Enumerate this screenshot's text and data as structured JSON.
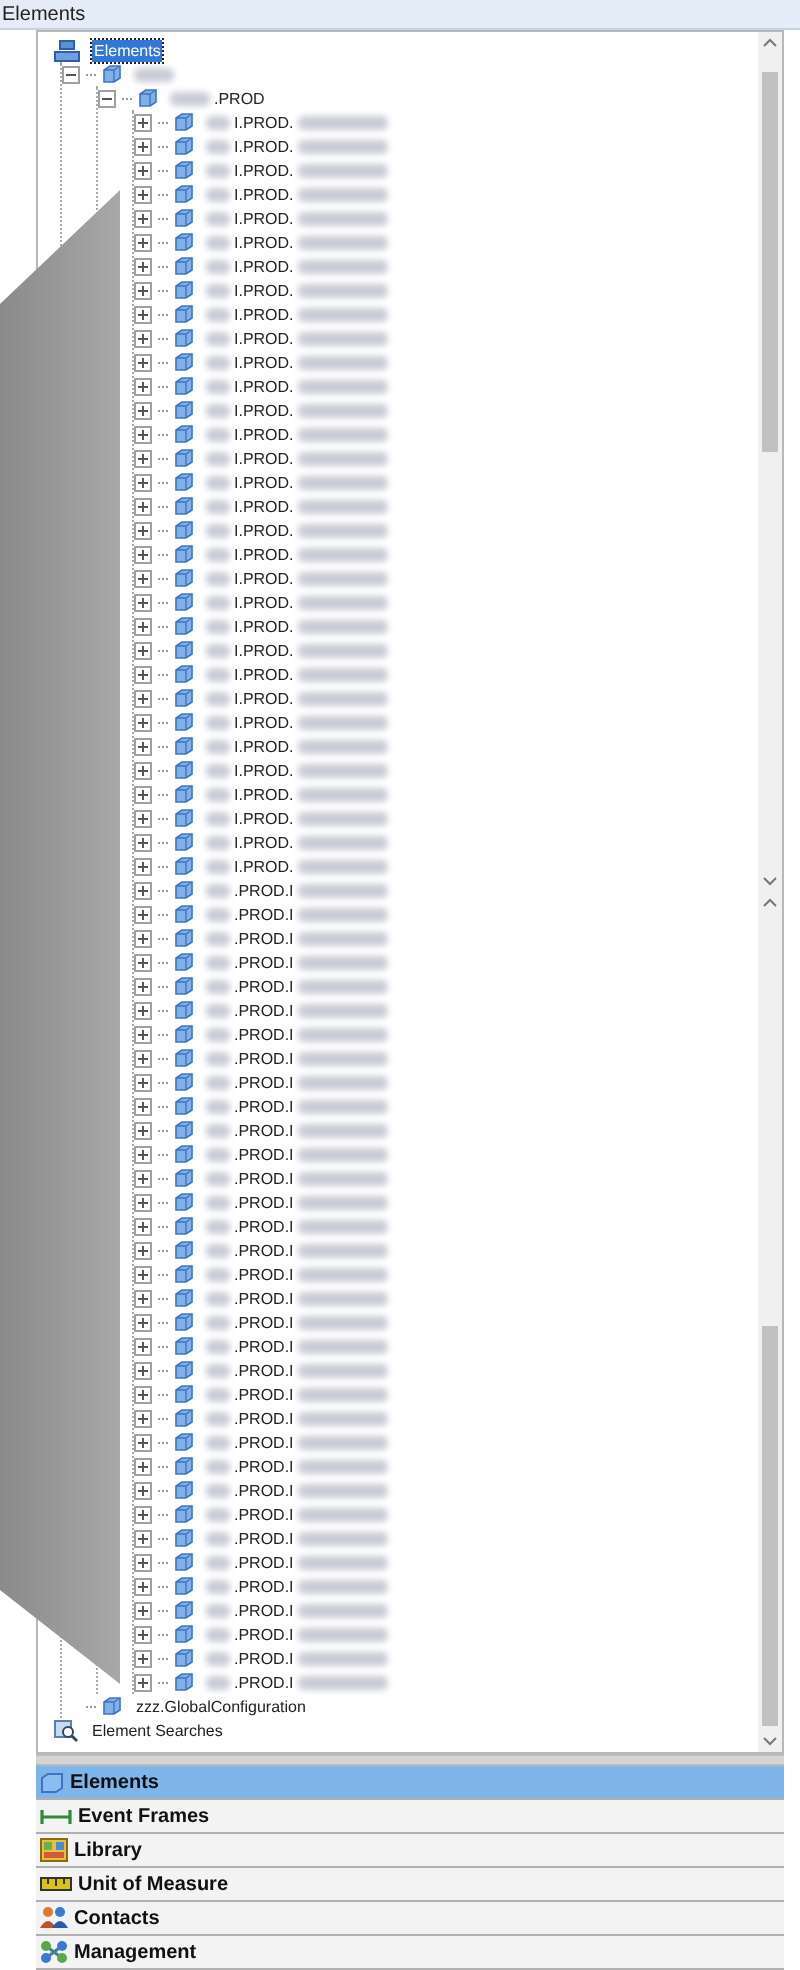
{
  "panel": {
    "title": "Elements"
  },
  "tree": [
    {
      "text": "Elements",
      "selected": true,
      "kind": "database",
      "children": [
        {
          "selected": false,
          "kind": "hidden",
          "expanded": true,
          "children": [
            {
              "text": ".PROD",
              "selected": false,
              "kind": "prod",
              "expanded": true,
              "children": [
                {
                  "text": "I.PROD.",
                  "selected": false,
                  "kind": "item",
                  "expanded": false
                },
                {
                  "text": "I.PROD.",
                  "selected": false,
                  "kind": "item",
                  "expanded": false
                },
                {
                  "text": "I.PROD.",
                  "selected": false,
                  "kind": "item",
                  "expanded": false
                },
                {
                  "text": "I.PROD.",
                  "selected": false,
                  "kind": "item",
                  "expanded": false
                },
                {
                  "text": "I.PROD.",
                  "selected": false,
                  "kind": "item",
                  "expanded": false
                },
                {
                  "text": "I.PROD.",
                  "selected": false,
                  "kind": "item",
                  "expanded": false
                },
                {
                  "text": "I.PROD.",
                  "selected": false,
                  "kind": "item",
                  "expanded": false
                },
                {
                  "text": "I.PROD.",
                  "selected": false,
                  "kind": "item",
                  "expanded": false
                },
                {
                  "text": "I.PROD.",
                  "selected": false,
                  "kind": "item",
                  "expanded": false
                },
                {
                  "text": "I.PROD.",
                  "selected": false,
                  "kind": "item",
                  "expanded": false
                },
                {
                  "text": "I.PROD.",
                  "selected": false,
                  "kind": "item",
                  "expanded": false
                },
                {
                  "text": "I.PROD.",
                  "selected": false,
                  "kind": "item",
                  "expanded": false
                },
                {
                  "text": "I.PROD.",
                  "selected": false,
                  "kind": "item",
                  "expanded": false
                },
                {
                  "text": "I.PROD.",
                  "selected": false,
                  "kind": "item",
                  "expanded": false
                },
                {
                  "text": "I.PROD.",
                  "selected": false,
                  "kind": "item",
                  "expanded": false
                },
                {
                  "text": "I.PROD.",
                  "selected": false,
                  "kind": "item",
                  "expanded": false
                },
                {
                  "text": "I.PROD.",
                  "selected": false,
                  "kind": "item",
                  "expanded": false
                },
                {
                  "text": "I.PROD.",
                  "selected": false,
                  "kind": "item",
                  "expanded": false
                },
                {
                  "text": "I.PROD.",
                  "selected": false,
                  "kind": "item",
                  "expanded": false
                },
                {
                  "text": "I.PROD.",
                  "selected": false,
                  "kind": "item",
                  "expanded": false
                },
                {
                  "text": "I.PROD.",
                  "selected": false,
                  "kind": "item",
                  "expanded": false
                },
                {
                  "text": "I.PROD.",
                  "selected": false,
                  "kind": "item",
                  "expanded": false
                },
                {
                  "text": "I.PROD.",
                  "selected": false,
                  "kind": "item",
                  "expanded": false
                },
                {
                  "text": "I.PROD.",
                  "selected": false,
                  "kind": "item",
                  "expanded": false
                },
                {
                  "text": "I.PROD.",
                  "selected": false,
                  "kind": "item",
                  "expanded": false
                },
                {
                  "text": "I.PROD.",
                  "selected": false,
                  "kind": "item",
                  "expanded": false
                },
                {
                  "text": "I.PROD.",
                  "selected": false,
                  "kind": "item",
                  "expanded": false
                },
                {
                  "text": "I.PROD.",
                  "selected": false,
                  "kind": "item",
                  "expanded": false
                },
                {
                  "text": "I.PROD.",
                  "selected": false,
                  "kind": "item",
                  "expanded": false
                },
                {
                  "text": "I.PROD.",
                  "selected": false,
                  "kind": "item",
                  "expanded": false
                },
                {
                  "text": "I.PROD.",
                  "selected": false,
                  "kind": "item",
                  "expanded": false
                },
                {
                  "text": "I.PROD.",
                  "selected": false,
                  "kind": "item",
                  "expanded": false
                },
                {
                  "text": ".PROD.I",
                  "selected": false,
                  "kind": "item",
                  "expanded": false
                },
                {
                  "text": ".PROD.I",
                  "selected": false,
                  "kind": "item",
                  "expanded": false
                },
                {
                  "text": ".PROD.I",
                  "selected": false,
                  "kind": "item",
                  "expanded": false
                },
                {
                  "text": ".PROD.I",
                  "selected": false,
                  "kind": "item",
                  "expanded": false
                },
                {
                  "text": ".PROD.I",
                  "selected": false,
                  "kind": "item",
                  "expanded": false
                },
                {
                  "text": ".PROD.I",
                  "selected": false,
                  "kind": "item",
                  "expanded": false
                },
                {
                  "text": ".PROD.I",
                  "selected": false,
                  "kind": "item",
                  "expanded": false
                },
                {
                  "text": ".PROD.I",
                  "selected": false,
                  "kind": "item",
                  "expanded": false
                },
                {
                  "text": ".PROD.I",
                  "selected": false,
                  "kind": "item",
                  "expanded": false
                },
                {
                  "text": ".PROD.I",
                  "selected": false,
                  "kind": "item",
                  "expanded": false
                },
                {
                  "text": ".PROD.I",
                  "selected": false,
                  "kind": "item",
                  "expanded": false
                },
                {
                  "text": ".PROD.I",
                  "selected": false,
                  "kind": "item",
                  "expanded": false
                },
                {
                  "text": ".PROD.I",
                  "selected": false,
                  "kind": "item",
                  "expanded": false
                },
                {
                  "text": ".PROD.I",
                  "selected": false,
                  "kind": "item",
                  "expanded": false
                },
                {
                  "text": ".PROD.I",
                  "selected": false,
                  "kind": "item",
                  "expanded": false
                },
                {
                  "text": ".PROD.I",
                  "selected": false,
                  "kind": "item",
                  "expanded": false
                },
                {
                  "text": ".PROD.I",
                  "selected": false,
                  "kind": "item",
                  "expanded": false
                },
                {
                  "text": ".PROD.I",
                  "selected": false,
                  "kind": "item",
                  "expanded": false
                },
                {
                  "text": ".PROD.I",
                  "selected": false,
                  "kind": "item",
                  "expanded": false
                },
                {
                  "text": ".PROD.I",
                  "selected": false,
                  "kind": "item",
                  "expanded": false
                },
                {
                  "text": ".PROD.I",
                  "selected": false,
                  "kind": "item",
                  "expanded": false
                },
                {
                  "text": ".PROD.I",
                  "selected": false,
                  "kind": "item",
                  "expanded": false
                },
                {
                  "text": ".PROD.I",
                  "selected": false,
                  "kind": "item",
                  "expanded": false
                },
                {
                  "text": ".PROD.I",
                  "selected": false,
                  "kind": "item",
                  "expanded": false
                },
                {
                  "text": ".PROD.I",
                  "selected": false,
                  "kind": "item",
                  "expanded": false
                },
                {
                  "text": ".PROD.I",
                  "selected": false,
                  "kind": "item",
                  "expanded": false
                },
                {
                  "text": ".PROD.I",
                  "selected": false,
                  "kind": "item",
                  "expanded": false
                },
                {
                  "text": ".PROD.I",
                  "selected": false,
                  "kind": "item",
                  "expanded": false
                },
                {
                  "text": ".PROD.I",
                  "selected": false,
                  "kind": "item",
                  "expanded": false
                },
                {
                  "text": ".PROD.I",
                  "selected": false,
                  "kind": "item",
                  "expanded": false
                },
                {
                  "text": ".PROD.I",
                  "selected": false,
                  "kind": "item",
                  "expanded": false
                },
                {
                  "text": ".PROD.I",
                  "selected": false,
                  "kind": "item",
                  "expanded": false
                },
                {
                  "text": ".PROD.I",
                  "selected": false,
                  "kind": "item",
                  "expanded": false
                },
                {
                  "text": ".PROD.I",
                  "selected": false,
                  "kind": "item",
                  "expanded": false
                }
              ]
            }
          ]
        },
        {
          "text": "zzz.GlobalConfiguration",
          "selected": false,
          "kind": "plain"
        }
      ]
    },
    {
      "text": "Element Searches",
      "selected": false,
      "kind": "search"
    }
  ],
  "navigation": [
    {
      "label": "Elements",
      "kind": "elements",
      "selected": true
    },
    {
      "label": "Event Frames",
      "kind": "events",
      "selected": false
    },
    {
      "label": "Library",
      "kind": "library",
      "selected": false
    },
    {
      "label": "Unit of Measure",
      "kind": "measure",
      "selected": false
    },
    {
      "label": "Contacts",
      "kind": "contacts",
      "selected": false
    },
    {
      "label": "Management",
      "kind": "management",
      "selected": false
    }
  ]
}
